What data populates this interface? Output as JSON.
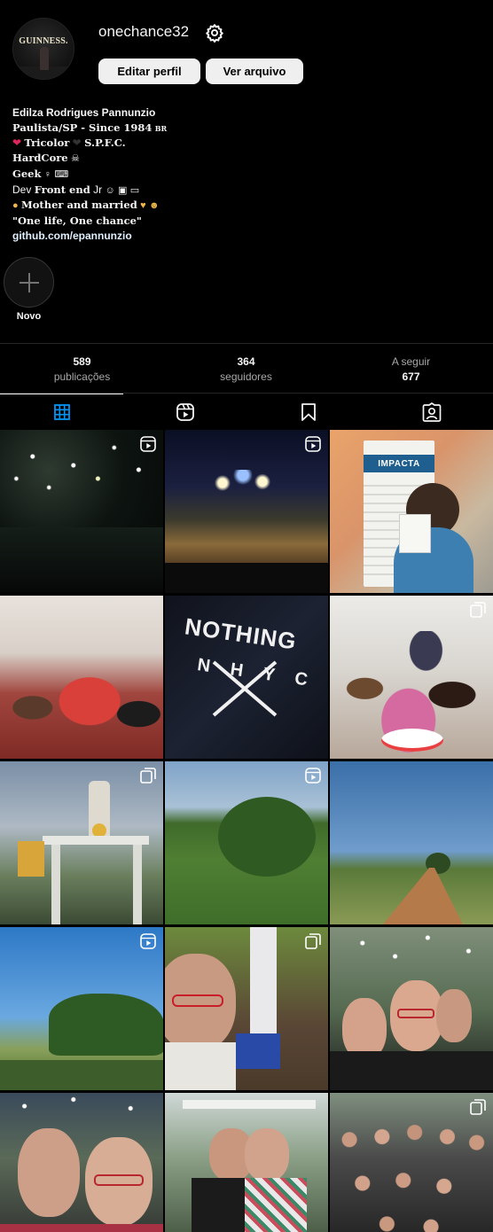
{
  "profile": {
    "username": "onechance32",
    "avatar_brand": "GUINNESS.",
    "edit_button": "Editar perfil",
    "archive_button": "Ver arquivo",
    "settings_icon": "gear-icon"
  },
  "bio": {
    "name": "Edilza Rodrigues Pannunzio",
    "line2": "Paulista/SP - Since 1984",
    "line2_flag": "BR",
    "line3_a": "Tricolor",
    "line3_b": "S.P.F.C.",
    "line4": "HardCore",
    "line5": "Geek",
    "line6_a": "Dev",
    "line6_b": "Front end",
    "line6_c": "Jr",
    "line7": "Mother and married",
    "line8": "\"One life, One chance\"",
    "link": "github.com/epannunzio"
  },
  "highlight": {
    "label": "Novo"
  },
  "stats": {
    "posts": {
      "value": "589",
      "label": "publicações"
    },
    "followers": {
      "value": "364",
      "label": "seguidores"
    },
    "following": {
      "label": "A seguir",
      "value": "677"
    }
  },
  "tabs": [
    {
      "name": "posts",
      "icon": "grid-icon",
      "active": true
    },
    {
      "name": "reels",
      "icon": "reels-icon",
      "active": false
    },
    {
      "name": "saved",
      "icon": "bookmark-icon",
      "active": false
    },
    {
      "name": "tagged",
      "icon": "tagged-icon",
      "active": false
    }
  ],
  "grid": {
    "impacta_sign": "IMPACTA",
    "shirt_text": "NOTHING",
    "shirt_letters": "N  H  Y  C"
  },
  "colors": {
    "background": "#000000",
    "button_bg": "#efefef",
    "divider": "#262626",
    "secondary_text": "#a8a8a8"
  }
}
